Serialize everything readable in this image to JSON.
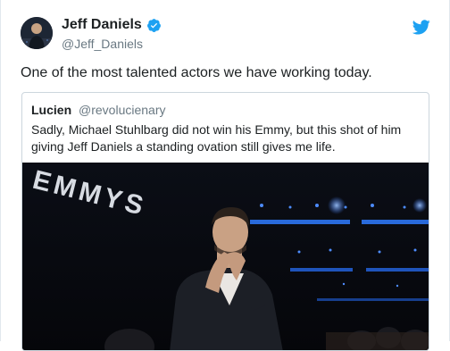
{
  "tweet": {
    "author_name": "Jeff Daniels",
    "author_handle": "@Jeff_Daniels",
    "text": "One of the most talented actors we have working today."
  },
  "quoted_tweet": {
    "author_name": "Lucien",
    "author_handle": "@revolucienary",
    "text": "Sadly, Michael Stuhlbarg did not win his Emmy, but this shot of him giving Jeff Daniels a standing ovation still gives me life.",
    "media_sign_text": "EMMYS"
  },
  "icons": {
    "verified": "verified-badge-icon",
    "platform": "twitter-bird-icon"
  },
  "colors": {
    "brand_blue": "#1da1f2",
    "text_primary": "#1c2022",
    "text_secondary": "#697882",
    "border": "#ccd6dd"
  }
}
